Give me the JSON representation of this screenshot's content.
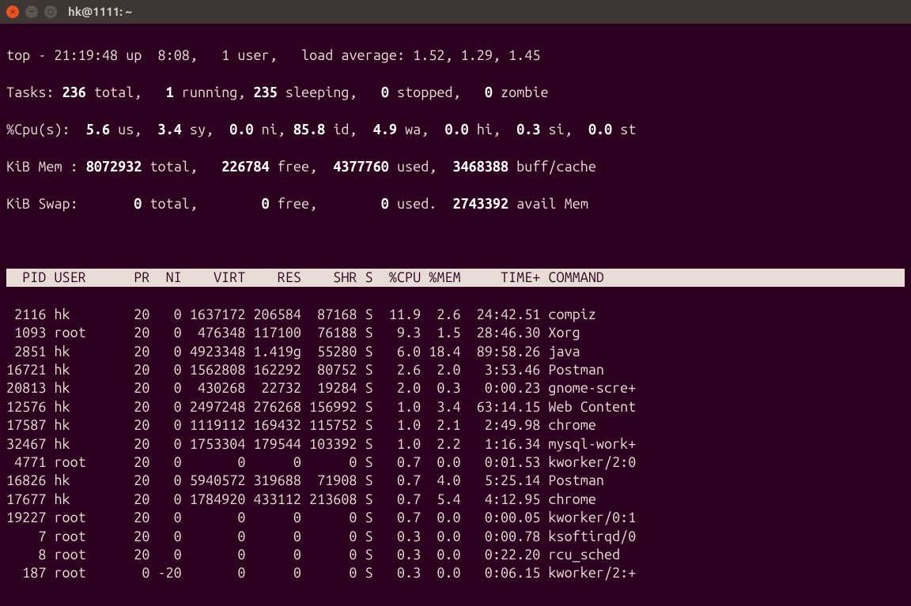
{
  "titlebar": {
    "title": "hk@1111: ~"
  },
  "summary": {
    "line1_prefix": "top - ",
    "time": "21:19:48",
    "up_label": " up  ",
    "uptime": "8:08",
    "users_sep": ",   ",
    "users": "1 user",
    "load_label": ",   load average: ",
    "load": "1.52, 1.29, 1.45",
    "tasks_label": "Tasks: ",
    "tasks_total": "236",
    "tasks_total_txt": " total,   ",
    "tasks_running": "1",
    "tasks_running_txt": " running, ",
    "tasks_sleeping": "235",
    "tasks_sleeping_txt": " sleeping,   ",
    "tasks_stopped": "0",
    "tasks_stopped_txt": " stopped,   ",
    "tasks_zombie": "0",
    "tasks_zombie_txt": " zombie",
    "cpu_label": "%Cpu(s):  ",
    "cpu_us": "5.6",
    "cpu_us_txt": " us,  ",
    "cpu_sy": "3.4",
    "cpu_sy_txt": " sy,  ",
    "cpu_ni": "0.0",
    "cpu_ni_txt": " ni, ",
    "cpu_id": "85.8",
    "cpu_id_txt": " id,  ",
    "cpu_wa": "4.9",
    "cpu_wa_txt": " wa,  ",
    "cpu_hi": "0.0",
    "cpu_hi_txt": " hi,  ",
    "cpu_si": "0.3",
    "cpu_si_txt": " si,  ",
    "cpu_st": "0.0",
    "cpu_st_txt": " st",
    "mem_label": "KiB Mem : ",
    "mem_total": "8072932",
    "mem_total_txt": " total,   ",
    "mem_free": "226784",
    "mem_free_txt": " free,  ",
    "mem_used": "4377760",
    "mem_used_txt": " used,  ",
    "mem_buff": "3468388",
    "mem_buff_txt": " buff/cache",
    "swap_label": "KiB Swap:       ",
    "swap_total": "0",
    "swap_total_txt": " total,        ",
    "swap_free": "0",
    "swap_free_txt": " free,        ",
    "swap_used": "0",
    "swap_used_txt": " used.  ",
    "swap_avail": "2743392",
    "swap_avail_txt": " avail Mem "
  },
  "header": "  PID USER      PR  NI    VIRT    RES    SHR S  %CPU %MEM     TIME+ COMMAND     ",
  "processes": [
    {
      "pid": " 2116",
      "user": "hk      ",
      "pr": "20",
      "ni": "  0",
      "virt": "1637172",
      "res": "206584",
      "shr": " 87168",
      "s": "S",
      "cpu": " 11.9",
      "mem": " 2.6",
      "time": " 24:42.51",
      "cmd": "compiz"
    },
    {
      "pid": " 1093",
      "user": "root    ",
      "pr": "20",
      "ni": "  0",
      "virt": " 476348",
      "res": "117100",
      "shr": " 76188",
      "s": "S",
      "cpu": "  9.3",
      "mem": " 1.5",
      "time": " 28:46.30",
      "cmd": "Xorg"
    },
    {
      "pid": " 2851",
      "user": "hk      ",
      "pr": "20",
      "ni": "  0",
      "virt": "4923348",
      "res": "1.419g",
      "shr": " 55280",
      "s": "S",
      "cpu": "  6.0",
      "mem": "18.4",
      "time": " 89:58.26",
      "cmd": "java"
    },
    {
      "pid": "16721",
      "user": "hk      ",
      "pr": "20",
      "ni": "  0",
      "virt": "1562808",
      "res": "162292",
      "shr": " 80752",
      "s": "S",
      "cpu": "  2.6",
      "mem": " 2.0",
      "time": "  3:53.46",
      "cmd": "Postman"
    },
    {
      "pid": "20813",
      "user": "hk      ",
      "pr": "20",
      "ni": "  0",
      "virt": " 430268",
      "res": " 22732",
      "shr": " 19284",
      "s": "S",
      "cpu": "  2.0",
      "mem": " 0.3",
      "time": "  0:00.23",
      "cmd": "gnome-scre+"
    },
    {
      "pid": "12576",
      "user": "hk      ",
      "pr": "20",
      "ni": "  0",
      "virt": "2497248",
      "res": "276268",
      "shr": "156992",
      "s": "S",
      "cpu": "  1.0",
      "mem": " 3.4",
      "time": " 63:14.15",
      "cmd": "Web Content"
    },
    {
      "pid": "17587",
      "user": "hk      ",
      "pr": "20",
      "ni": "  0",
      "virt": "1119112",
      "res": "169432",
      "shr": "115752",
      "s": "S",
      "cpu": "  1.0",
      "mem": " 2.1",
      "time": "  2:49.98",
      "cmd": "chrome"
    },
    {
      "pid": "32467",
      "user": "hk      ",
      "pr": "20",
      "ni": "  0",
      "virt": "1753304",
      "res": "179544",
      "shr": "103392",
      "s": "S",
      "cpu": "  1.0",
      "mem": " 2.2",
      "time": "  1:16.34",
      "cmd": "mysql-work+"
    },
    {
      "pid": " 4771",
      "user": "root    ",
      "pr": "20",
      "ni": "  0",
      "virt": "      0",
      "res": "     0",
      "shr": "     0",
      "s": "S",
      "cpu": "  0.7",
      "mem": " 0.0",
      "time": "  0:01.53",
      "cmd": "kworker/2:0"
    },
    {
      "pid": "16826",
      "user": "hk      ",
      "pr": "20",
      "ni": "  0",
      "virt": "5940572",
      "res": "319688",
      "shr": " 71908",
      "s": "S",
      "cpu": "  0.7",
      "mem": " 4.0",
      "time": "  5:25.14",
      "cmd": "Postman"
    },
    {
      "pid": "17677",
      "user": "hk      ",
      "pr": "20",
      "ni": "  0",
      "virt": "1784920",
      "res": "433112",
      "shr": "213608",
      "s": "S",
      "cpu": "  0.7",
      "mem": " 5.4",
      "time": "  4:12.95",
      "cmd": "chrome"
    },
    {
      "pid": "19227",
      "user": "root    ",
      "pr": "20",
      "ni": "  0",
      "virt": "      0",
      "res": "     0",
      "shr": "     0",
      "s": "S",
      "cpu": "  0.7",
      "mem": " 0.0",
      "time": "  0:00.05",
      "cmd": "kworker/0:1"
    },
    {
      "pid": "    7",
      "user": "root    ",
      "pr": "20",
      "ni": "  0",
      "virt": "      0",
      "res": "     0",
      "shr": "     0",
      "s": "S",
      "cpu": "  0.3",
      "mem": " 0.0",
      "time": "  0:00.78",
      "cmd": "ksoftirqd/0"
    },
    {
      "pid": "    8",
      "user": "root    ",
      "pr": "20",
      "ni": "  0",
      "virt": "      0",
      "res": "     0",
      "shr": "     0",
      "s": "S",
      "cpu": "  0.3",
      "mem": " 0.0",
      "time": "  0:22.20",
      "cmd": "rcu_sched"
    },
    {
      "pid": "  187",
      "user": "root    ",
      "pr": " 0",
      "ni": "-20",
      "virt": "      0",
      "res": "     0",
      "shr": "     0",
      "s": "S",
      "cpu": "  0.3",
      "mem": " 0.0",
      "time": "  0:06.15",
      "cmd": "kworker/2:+"
    }
  ]
}
